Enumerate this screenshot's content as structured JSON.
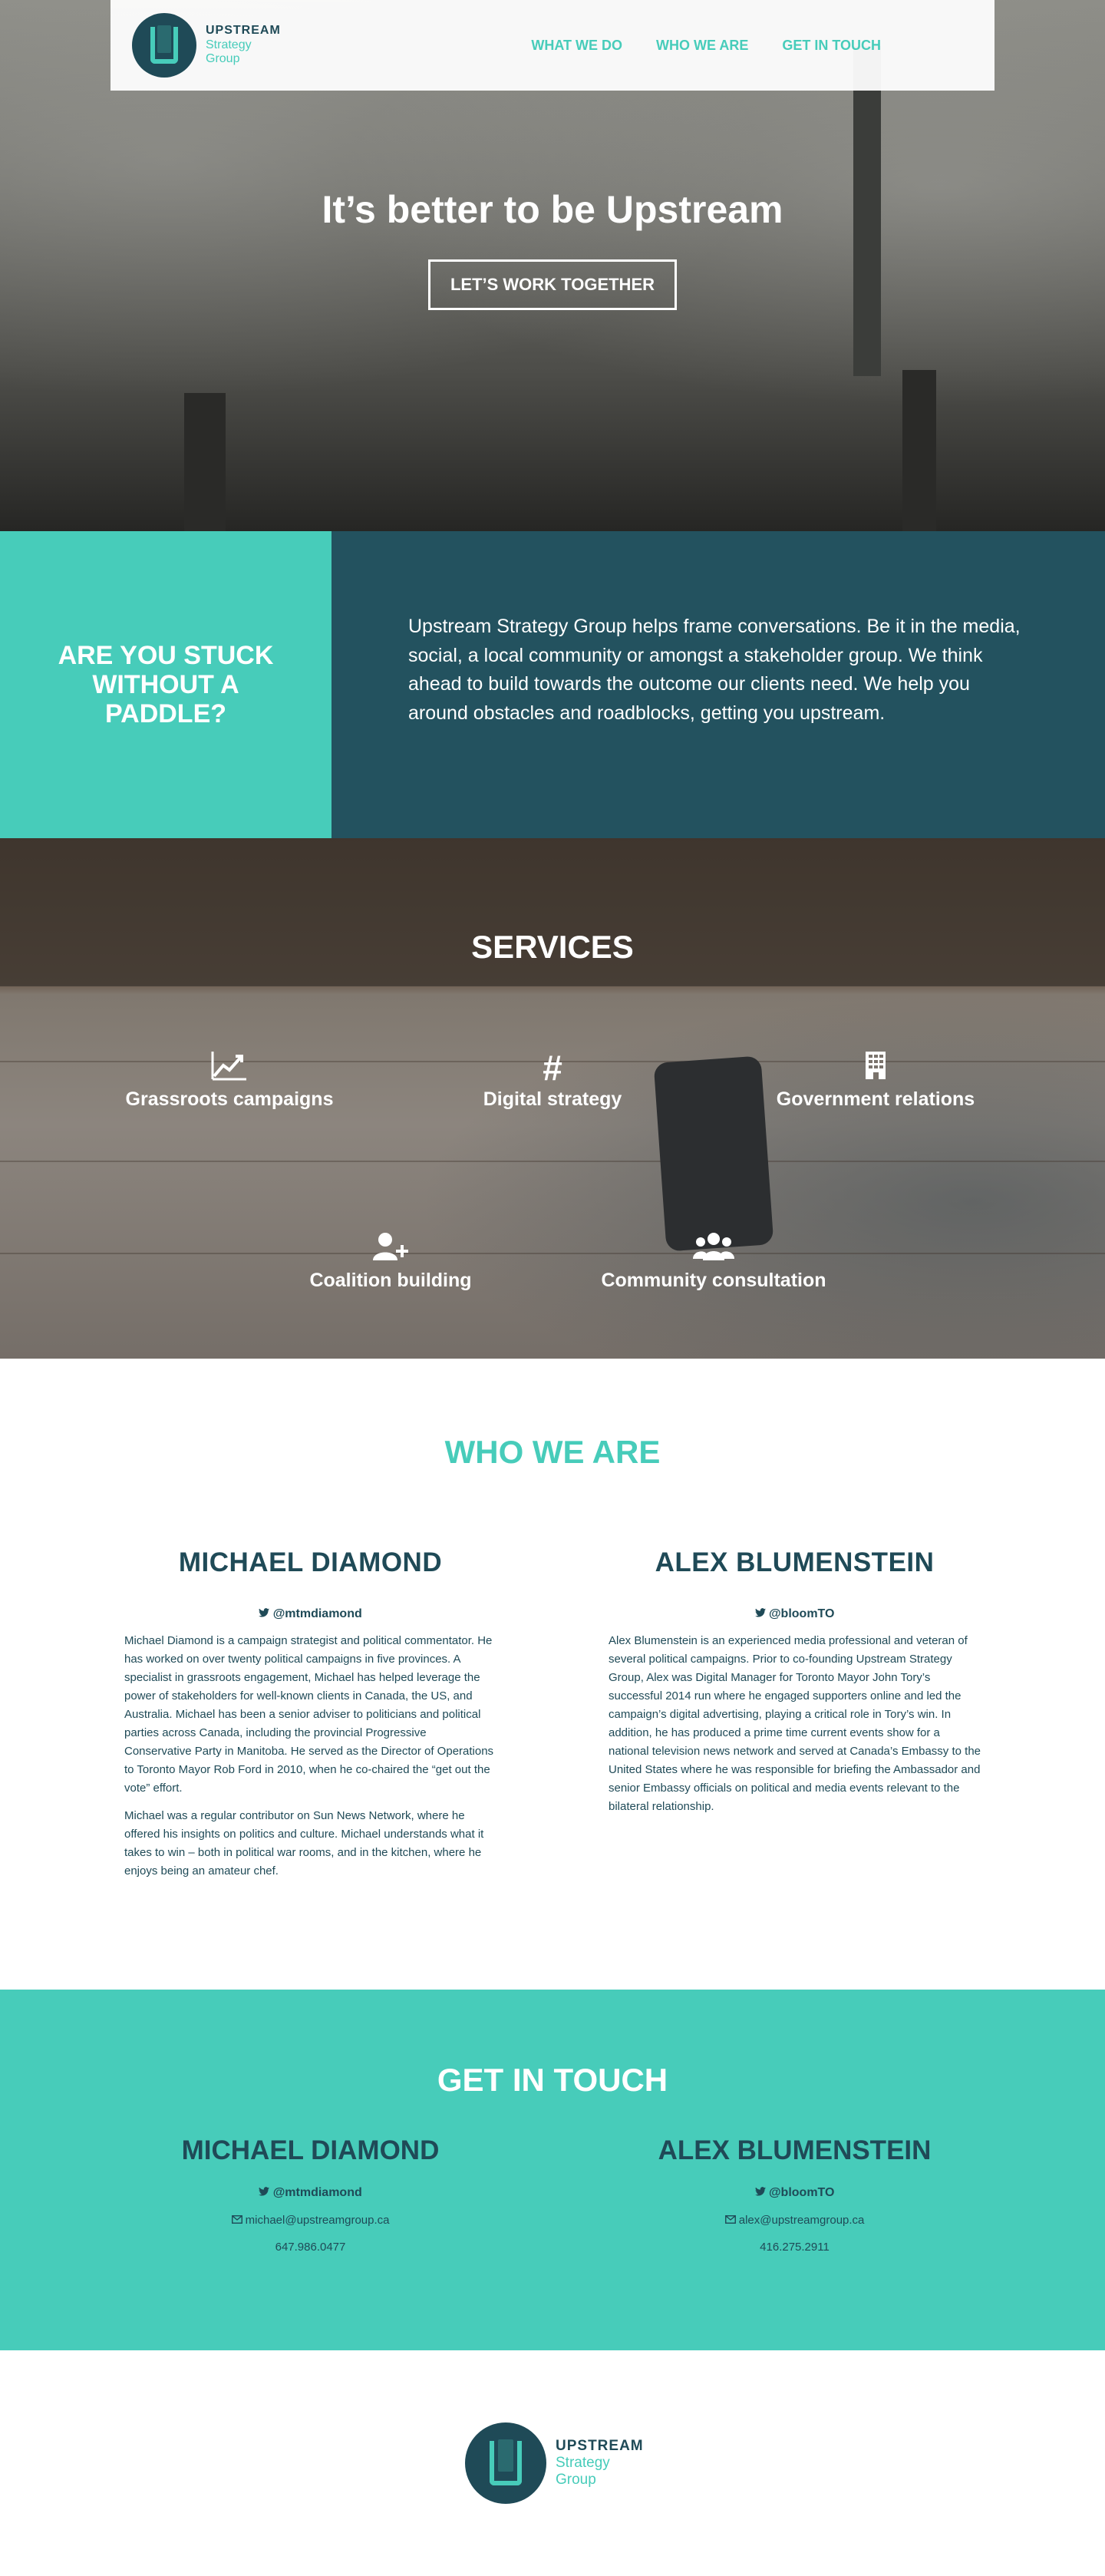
{
  "brand": {
    "line1": "UPSTREAM",
    "line2": "Strategy",
    "line3": "Group"
  },
  "nav": {
    "items": [
      "WHAT WE DO",
      "WHO WE ARE",
      "GET IN TOUCH"
    ]
  },
  "hero": {
    "title": "It’s better to be Upstream",
    "cta_label": "LET’S WORK TOGETHER"
  },
  "intro": {
    "heading": "ARE YOU STUCK WITHOUT A PADDLE?",
    "body": "Upstream Strategy Group helps frame conversations. Be it in the media, social, a local community or amongst a stakeholder group. We think ahead to build towards the outcome our clients need.  We help you around obstacles and roadblocks, getting you upstream."
  },
  "services": {
    "title": "SERVICES",
    "items": [
      {
        "label": "Grassroots campaigns",
        "icon": "chart-line-icon",
        "glyph": "📈"
      },
      {
        "label": "Digital strategy",
        "icon": "hashtag-icon",
        "glyph": "#"
      },
      {
        "label": "Government relations",
        "icon": "building-icon",
        "glyph": "▦"
      },
      {
        "label": "Coalition building",
        "icon": "user-plus-icon",
        "glyph": "👤"
      },
      {
        "label": "Community consultation",
        "icon": "users-icon",
        "glyph": "👥"
      }
    ]
  },
  "who": {
    "title": "WHO WE ARE",
    "people": [
      {
        "name": "MICHAEL DIAMOND",
        "handle": "@mtmdiamond",
        "bio": [
          "Michael Diamond is a campaign strategist and political commentator. He has worked on over twenty political campaigns in five provinces. A specialist in grassroots engagement, Michael has helped leverage the power of stakeholders for well-known clients in Canada, the US, and Australia. Michael has been a senior adviser to politicians and political parties across Canada, including the provincial Progressive Conservative Party in Manitoba. He served as the Director of Operations to Toronto Mayor Rob Ford in 2010, when he co-chaired the “get out the vote” effort.",
          "Michael was a regular contributor on Sun News Network, where he offered his insights on politics and culture. Michael understands what it takes to win – both in political war rooms, and in the kitchen, where he enjoys being an amateur chef."
        ]
      },
      {
        "name": "ALEX BLUMENSTEIN",
        "handle": "@bloomTO",
        "bio": [
          "Alex Blumenstein is an experienced media professional and veteran of several political campaigns. Prior to co-founding Upstream Strategy Group, Alex was Digital Manager for Toronto Mayor John Tory’s successful 2014 run where he engaged supporters online and led the campaign’s digital advertising, playing a critical role in Tory’s win. In addition, he has produced a prime time current events show for a national television news network and served at Canada’s Embassy to the United States where he was responsible for briefing the Ambassador and senior Embassy officials on political and media events relevant to the bilateral relationship."
        ]
      }
    ]
  },
  "contact": {
    "title": "GET IN TOUCH",
    "people": [
      {
        "name": "MICHAEL DIAMOND",
        "handle": "@mtmdiamond",
        "email": "michael@upstreamgroup.ca",
        "phone": "647.986.0477"
      },
      {
        "name": "ALEX BLUMENSTEIN",
        "handle": "@bloomTO",
        "email": "alex@upstreamgroup.ca",
        "phone": "416.275.2911"
      }
    ]
  },
  "colors": {
    "teal": "#47ccba",
    "navy": "#1f4a57",
    "intro_right": "#23525f"
  }
}
